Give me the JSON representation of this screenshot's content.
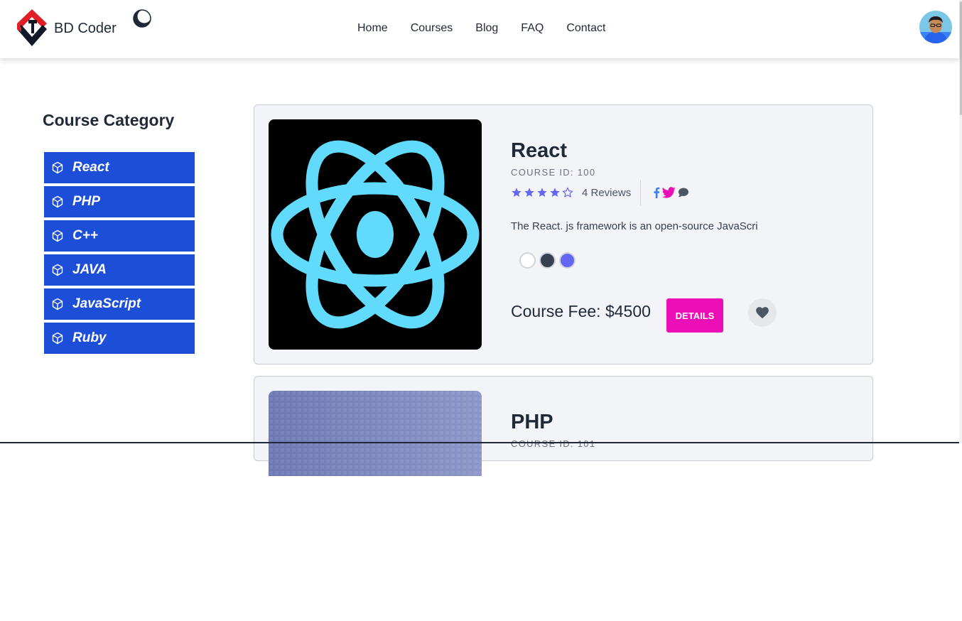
{
  "brand": {
    "name": "BD Coder"
  },
  "nav": {
    "links": [
      "Home",
      "Courses",
      "Blog",
      "FAQ",
      "Contact"
    ]
  },
  "sidebar": {
    "title": "Course Category",
    "items": [
      "React",
      "PHP",
      "C++",
      "JAVA",
      "JavaScript",
      "Ruby"
    ]
  },
  "courses": [
    {
      "title": "React",
      "course_id": "COURSE ID: 100",
      "rating": 4,
      "rating_max": 5,
      "reviews": "4 Reviews",
      "description": "The React. js framework is an open-source JavaScri",
      "swatch_colors": [
        "#ffffff",
        "#374151",
        "#6366f1"
      ],
      "fee": "Course Fee: $4500",
      "details_label": "DETAILS"
    },
    {
      "title": "PHP",
      "course_id": "COURSE ID: 101"
    }
  ],
  "colors": {
    "category_bg": "#1d4ed8",
    "details_bg": "#ec0fb7",
    "star": "#6366f1",
    "react_logo": "#61dafb",
    "facebook": "#3b82f6",
    "twitter": "#ec0fb7",
    "chat": "#4b5563"
  },
  "icons": {
    "logo": "bd-coder-logo",
    "theme": "moon-icon",
    "category": "cube-icon",
    "favorite": "heart-icon"
  }
}
